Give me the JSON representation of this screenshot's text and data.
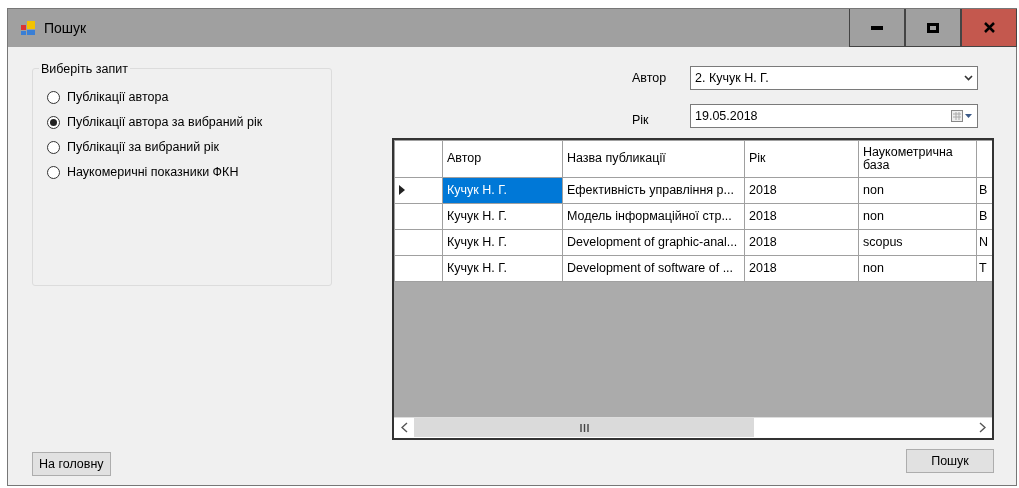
{
  "window": {
    "title": "Пошук"
  },
  "query_group": {
    "title": "Виберіть запит",
    "options": [
      {
        "label": "Публікації автора",
        "selected": false
      },
      {
        "label": "Публікації автора за вибраний рік",
        "selected": true
      },
      {
        "label": "Публікації за вибраний рік",
        "selected": false
      },
      {
        "label": "Наукомеричні показники ФКН",
        "selected": false
      }
    ]
  },
  "author": {
    "label": "Автор",
    "value": "2. Кучук  Н. Г."
  },
  "year": {
    "label": "Рік",
    "value": "19.05.2018"
  },
  "table": {
    "columns": [
      "Автор",
      "Назва публикації",
      "Рік",
      "Наукометрична база"
    ],
    "rows": [
      {
        "current": true,
        "cells": [
          {
            "text": "Кучук  Н. Г.",
            "selected": true
          },
          {
            "text": "Ефективність управління р...",
            "selected": false
          },
          {
            "text": "2018",
            "selected": false
          },
          {
            "text": "non",
            "selected": false
          },
          {
            "text": "В",
            "selected": false
          }
        ]
      },
      {
        "current": false,
        "cells": [
          {
            "text": "Кучук  Н. Г.",
            "selected": false
          },
          {
            "text": "Модель інформаційної стр...",
            "selected": false
          },
          {
            "text": "2018",
            "selected": false
          },
          {
            "text": "non",
            "selected": false
          },
          {
            "text": "В",
            "selected": false
          }
        ]
      },
      {
        "current": false,
        "cells": [
          {
            "text": "Кучук  Н. Г.",
            "selected": false
          },
          {
            "text": "Development of graphic-anal...",
            "selected": false
          },
          {
            "text": "2018",
            "selected": false
          },
          {
            "text": "scopus",
            "selected": false
          },
          {
            "text": "N",
            "selected": false
          }
        ]
      },
      {
        "current": false,
        "cells": [
          {
            "text": "Кучук  Н. Г.",
            "selected": false
          },
          {
            "text": "Development of software of ...",
            "selected": false
          },
          {
            "text": "2018",
            "selected": false
          },
          {
            "text": "non",
            "selected": false
          },
          {
            "text": "Т",
            "selected": false
          }
        ]
      }
    ]
  },
  "buttons": {
    "home": "На головну",
    "search": "Пошук"
  }
}
